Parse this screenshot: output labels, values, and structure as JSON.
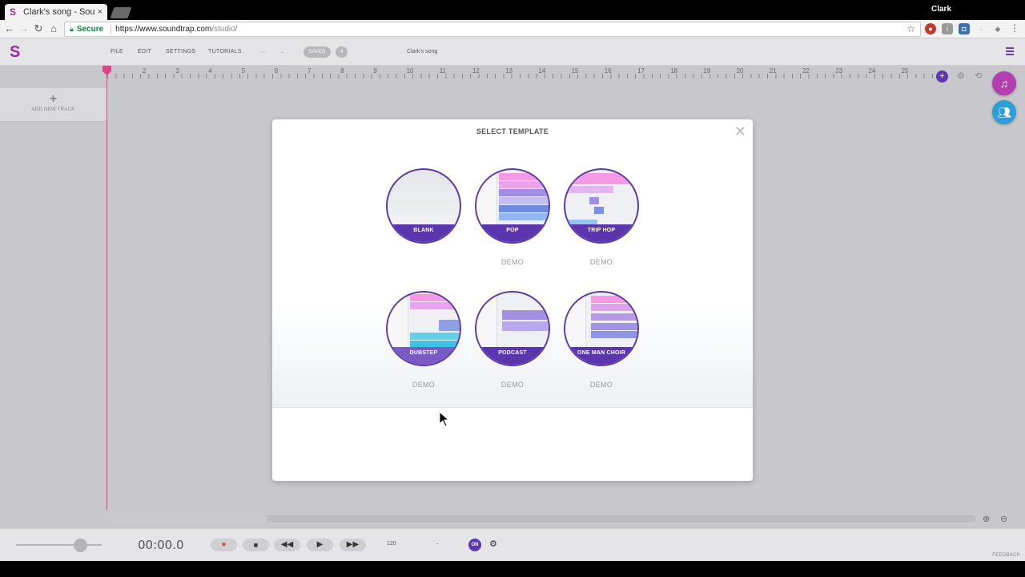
{
  "browser": {
    "tab_title": "Clark's song - Soun",
    "tab_close": "×",
    "profile_name": "Clark",
    "secure_label": "Secure",
    "url_host": "https://www.soundtrap.com",
    "url_path": "/studio/"
  },
  "app": {
    "menu": {
      "file": "FILE",
      "edit": "EDIT",
      "settings": "SETTINGS",
      "tutorials": "TUTORIALS"
    },
    "saved_label": "SAVED",
    "history_count": "4",
    "song_title": "Clark's song",
    "brand_colors": {
      "purple": "#5c37ad",
      "magenta": "#9b2a9c",
      "playhead": "#d8478e",
      "blue": "#2d9fd6"
    }
  },
  "ruler": {
    "marks": [
      "2",
      "3",
      "4",
      "5",
      "6",
      "7",
      "8",
      "9",
      "10",
      "11",
      "12",
      "13",
      "14",
      "15",
      "16",
      "17",
      "18",
      "19",
      "20",
      "21",
      "22",
      "23",
      "24",
      "25"
    ]
  },
  "left_panel": {
    "add_track_label": "ADD NEW TRACK"
  },
  "modal": {
    "title": "SELECT TEMPLATE",
    "templates": [
      {
        "name": "BLANK",
        "demo": ""
      },
      {
        "name": "POP",
        "demo": "DEMO"
      },
      {
        "name": "TRIP HOP",
        "demo": "DEMO"
      },
      {
        "name": "DUBSTEP",
        "demo": "DEMO"
      },
      {
        "name": "PODCAST",
        "demo": "DEMO"
      },
      {
        "name": "ONE MAN CHOIR",
        "demo": "DEMO"
      }
    ]
  },
  "transport": {
    "time": "00:00.0",
    "bpm": "120",
    "key": "-",
    "metronome_label": "ON",
    "feedback_label": "FEEDBACK"
  }
}
